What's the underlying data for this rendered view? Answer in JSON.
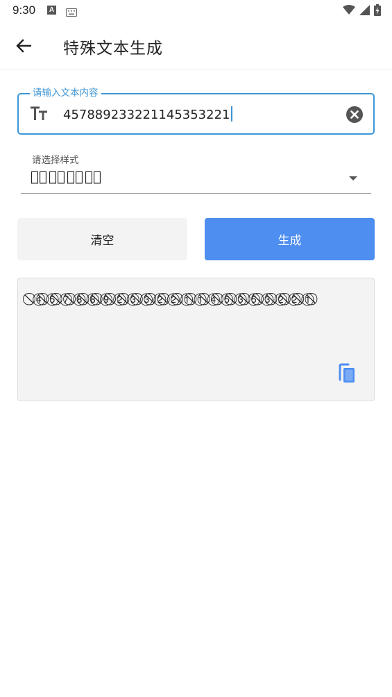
{
  "status_bar": {
    "time": "9:30",
    "notification_icons": [
      "font-a-icon",
      "keyboard-icon"
    ],
    "system_icons": [
      "wifi-icon",
      "signal-icon",
      "battery-charging-icon"
    ]
  },
  "toolbar": {
    "title": "特殊文本生成",
    "back_icon": "arrow-left-icon"
  },
  "input": {
    "label": "请输入文本内容",
    "value": "457889233221145353221",
    "lead_icon": "text-size-icon",
    "trail_icon": "clear-circle-icon"
  },
  "style_select": {
    "label": "请选择样式",
    "selected": "测⃠试⃠测⃠试⃠",
    "arrow_icon": "dropdown-arrow-icon"
  },
  "buttons": {
    "clear_label": "清空",
    "generate_label": "生成"
  },
  "result": {
    "text": "⃠④⃠⑤⃠⑦⃠⑧⃠⑧⃠⑨⃠②⃠③⃠③⃠②⃠②⃠①⃠①⃠④⃠⑤⃠③⃠⑤⃠③⃠②⃠②⃠①⃠",
    "copy_icon": "copy-icon"
  },
  "colors": {
    "accent": "#3d95d5",
    "primary_button": "#4d8ef0",
    "secondary_button": "#f3f3f3",
    "result_background": "#f3f3f3"
  }
}
